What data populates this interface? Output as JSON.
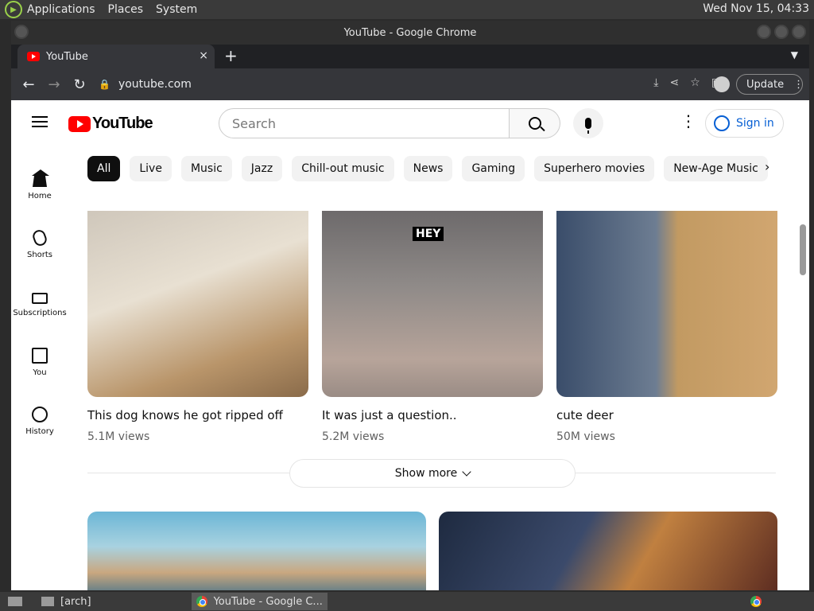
{
  "system": {
    "menus": [
      "Applications",
      "Places",
      "System"
    ],
    "clock": "Wed Nov 15, 04:33"
  },
  "window": {
    "title": "YouTube - Google Chrome"
  },
  "tab": {
    "title": "YouTube",
    "close": "×",
    "new": "+"
  },
  "toolbar": {
    "url": "youtube.com",
    "update_label": "Update"
  },
  "youtube": {
    "logo_text": "YouTube",
    "search_placeholder": "Search",
    "signin_label": "Sign in",
    "chips": [
      "All",
      "Live",
      "Music",
      "Jazz",
      "Chill-out music",
      "News",
      "Gaming",
      "Superhero movies",
      "New-Age Music"
    ],
    "guide": [
      "Home",
      "Shorts",
      "Subscriptions",
      "You",
      "History"
    ],
    "videos": [
      {
        "title": "This dog knows he got ripped off ",
        "views": "5.1M views"
      },
      {
        "title": "It was just a question.. ",
        "views": "5.2M views",
        "overlay": "HEY"
      },
      {
        "title": "cute deer  ",
        "views": "50M views"
      }
    ],
    "show_more": "Show more"
  },
  "taskbar": {
    "items": [
      "[arch]",
      "YouTube - Google C..."
    ]
  }
}
